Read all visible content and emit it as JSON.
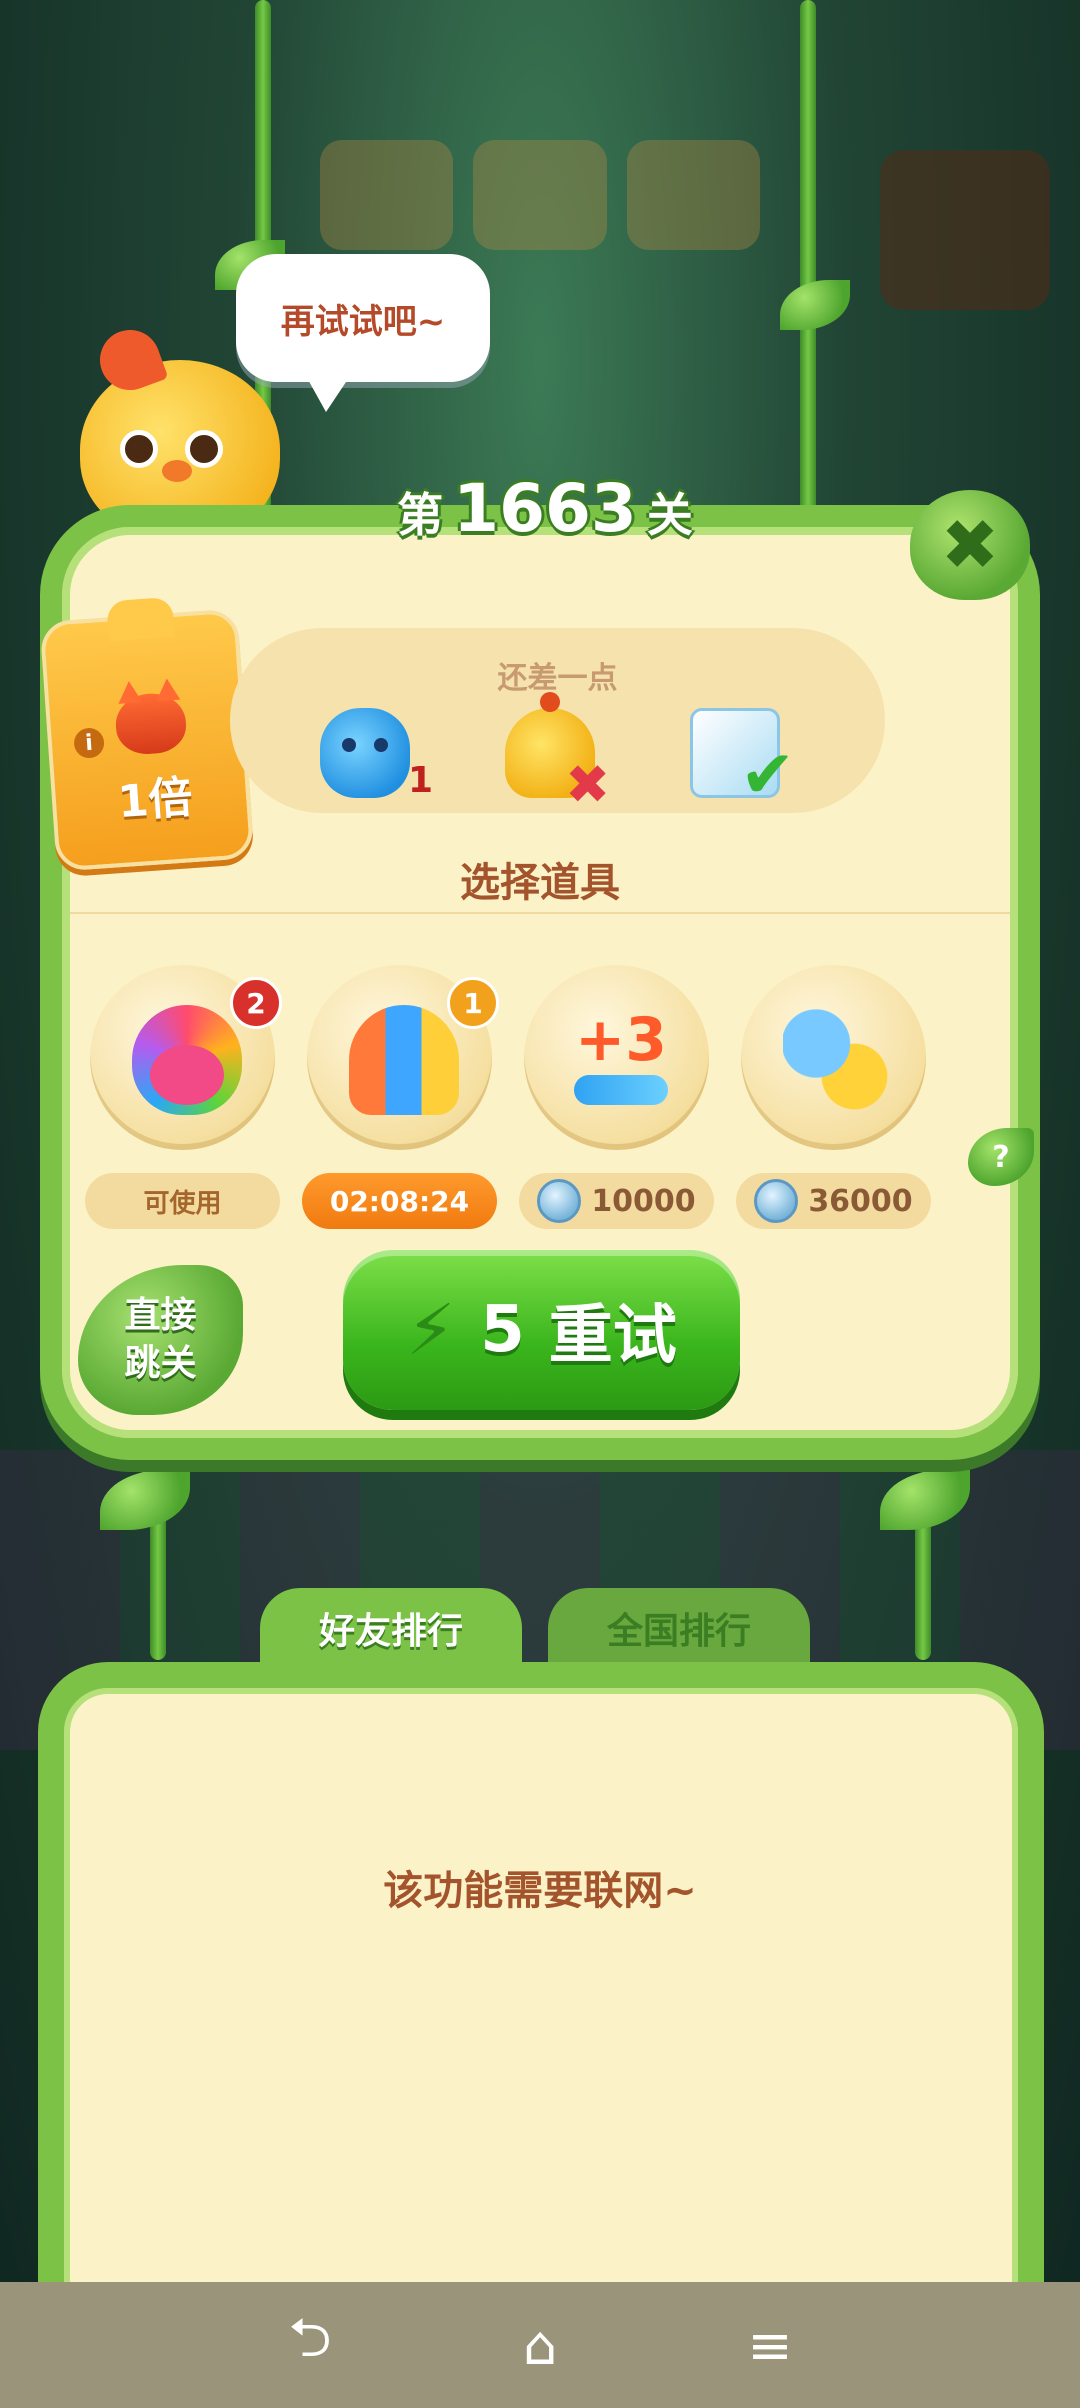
{
  "speech_bubble": "再试试吧~",
  "level": {
    "prefix": "第",
    "number": "1663",
    "suffix": "关"
  },
  "close_icon": "✖",
  "multiplier": {
    "info_icon": "i",
    "label": "1倍"
  },
  "goals": {
    "hint": "还差一点",
    "hippo_count": "1",
    "status_fail_icon": "✖",
    "status_done_icon": "✔"
  },
  "section_title": "选择道具",
  "boosters": [
    {
      "badge": "2",
      "label": "可使用"
    },
    {
      "badge": "1",
      "label": "02:08:24"
    },
    {
      "art_text": "+3",
      "price": "10000"
    },
    {
      "price": "36000"
    }
  ],
  "help_icon": "?",
  "skip_button": {
    "line1": "直接",
    "line2": "跳关"
  },
  "retry_button": {
    "cost": "5",
    "label": "重试",
    "icon": "lightning-icon"
  },
  "tabs": [
    "好友排行",
    "全国排行"
  ],
  "offline_message": "该功能需要联网~",
  "navbar": {
    "back": "⮌",
    "home": "⌂",
    "menu": "≡"
  },
  "colors": {
    "panel_bg": "#fbf3c7",
    "vine_green": "#7cc246",
    "accent_orange": "#f59f1d",
    "retry_green": "#3ab51c",
    "text_brown": "#a4542c"
  }
}
